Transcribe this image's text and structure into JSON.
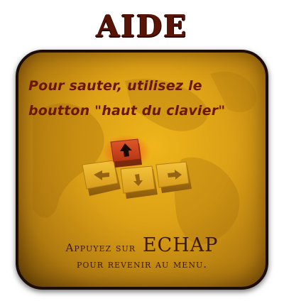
{
  "screen": {
    "title": "AIDE",
    "instruction_line1": "Pour sauter, utilisez le",
    "instruction_line2": "boutton  \"haut du clavier\""
  },
  "footer": {
    "line1_prefix": "Appuyez sur",
    "line1_key": "ECHAP",
    "line2": "pour revenir au menu."
  },
  "keys": {
    "highlighted": "arrow-up-key",
    "others": [
      "arrow-left-key",
      "arrow-down-key",
      "arrow-right-key"
    ]
  },
  "colors": {
    "panel": "#dca016",
    "title": "#5a1406",
    "instruction_text": "#6b1606",
    "highlight_key": "#c2421a"
  }
}
